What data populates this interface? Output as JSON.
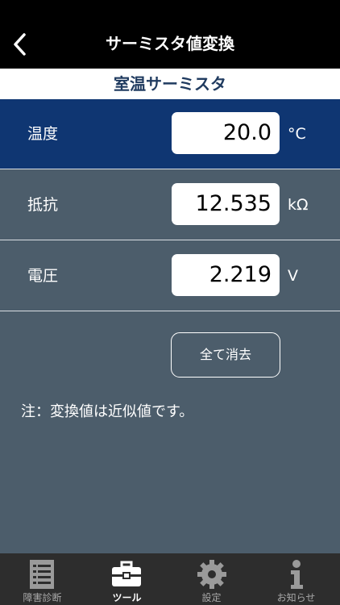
{
  "header": {
    "title": "サーミスタ値変換"
  },
  "subheader": {
    "title": "室温サーミスタ"
  },
  "rows": [
    {
      "label": "温度",
      "value": "20.0",
      "unit": "°C"
    },
    {
      "label": "抵抗",
      "value": "12.535",
      "unit": "kΩ"
    },
    {
      "label": "電圧",
      "value": "2.219",
      "unit": "V"
    }
  ],
  "actions": {
    "clear_all": "全て消去"
  },
  "note": "注：変換値は近似値です。",
  "tabs": [
    {
      "label": "障害診断",
      "icon": "document-list-icon"
    },
    {
      "label": "ツール",
      "icon": "toolbox-icon"
    },
    {
      "label": "設定",
      "icon": "gear-icon"
    },
    {
      "label": "お知らせ",
      "icon": "info-icon"
    }
  ],
  "colors": {
    "active_row": "#0f3672",
    "row": "#4c5d6b",
    "header": "#000000",
    "subheader_text": "#1f3a5f",
    "tabbar": "#2d2d2d"
  }
}
